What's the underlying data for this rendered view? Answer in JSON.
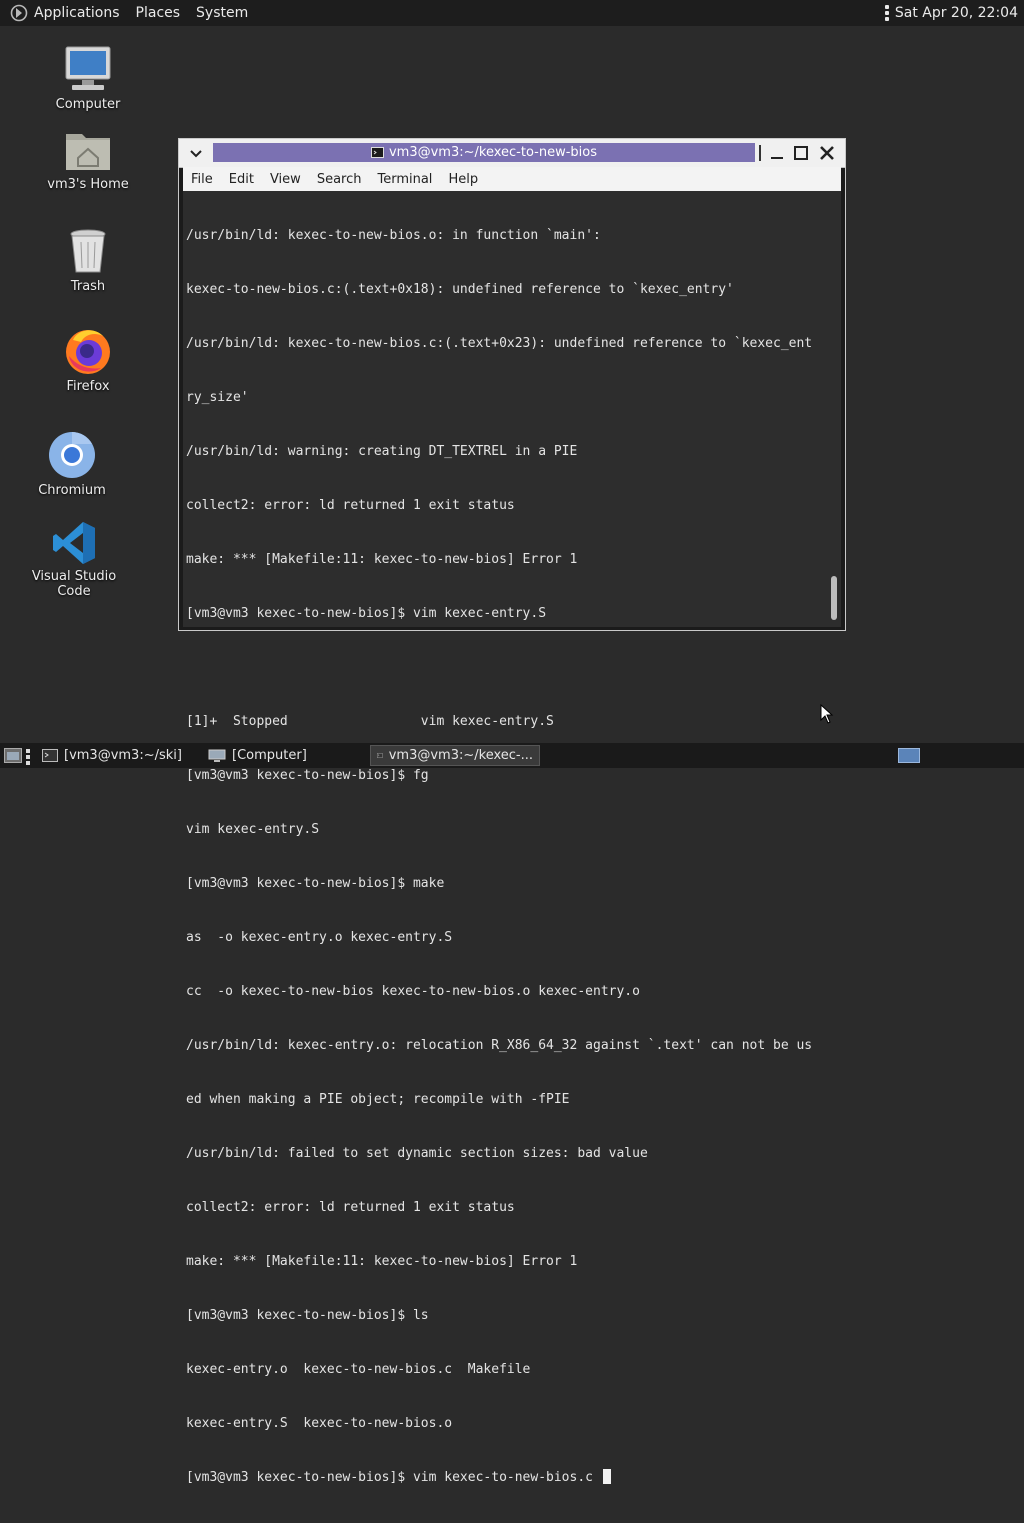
{
  "top_panel": {
    "menus": [
      "Applications",
      "Places",
      "System"
    ],
    "clock": "Sat Apr 20, 22:04"
  },
  "desktop_icons": [
    {
      "label": "Computer",
      "icon": "computer-icon"
    },
    {
      "label": "vm3's Home",
      "icon": "home-folder-icon"
    },
    {
      "label": "Trash",
      "icon": "trash-icon"
    },
    {
      "label": "Firefox",
      "icon": "firefox-icon"
    },
    {
      "label": "Chromium",
      "icon": "chromium-icon"
    },
    {
      "label": "Visual Studio Code",
      "icon": "vscode-icon"
    }
  ],
  "terminal": {
    "title": "vm3@vm3:~/kexec-to-new-bios",
    "menu": [
      "File",
      "Edit",
      "View",
      "Search",
      "Terminal",
      "Help"
    ],
    "lines": [
      "/usr/bin/ld: kexec-to-new-bios.o: in function `main':",
      "kexec-to-new-bios.c:(.text+0x18): undefined reference to `kexec_entry'",
      "/usr/bin/ld: kexec-to-new-bios.c:(.text+0x23): undefined reference to `kexec_ent",
      "ry_size'",
      "/usr/bin/ld: warning: creating DT_TEXTREL in a PIE",
      "collect2: error: ld returned 1 exit status",
      "make: *** [Makefile:11: kexec-to-new-bios] Error 1",
      "[vm3@vm3 kexec-to-new-bios]$ vim kexec-entry.S",
      "",
      "[1]+  Stopped                 vim kexec-entry.S",
      "[vm3@vm3 kexec-to-new-bios]$ fg",
      "vim kexec-entry.S",
      "[vm3@vm3 kexec-to-new-bios]$ make",
      "as  -o kexec-entry.o kexec-entry.S",
      "cc  -o kexec-to-new-bios kexec-to-new-bios.o kexec-entry.o",
      "/usr/bin/ld: kexec-entry.o: relocation R_X86_64_32 against `.text' can not be us",
      "ed when making a PIE object; recompile with -fPIE",
      "/usr/bin/ld: failed to set dynamic section sizes: bad value",
      "collect2: error: ld returned 1 exit status",
      "make: *** [Makefile:11: kexec-to-new-bios] Error 1",
      "[vm3@vm3 kexec-to-new-bios]$ ls",
      "kexec-entry.o  kexec-to-new-bios.c  Makefile",
      "kexec-entry.S  kexec-to-new-bios.o"
    ],
    "prompt_line": "[vm3@vm3 kexec-to-new-bios]$ vim kexec-to-new-bios.c "
  },
  "taskbar": {
    "tasks": [
      "[vm3@vm3:~/ski]",
      "[Computer]",
      "vm3@vm3:~/kexec-..."
    ]
  },
  "colors": {
    "title_highlight": "#7b71b2",
    "workspace_indicator": "#5b84b9"
  }
}
